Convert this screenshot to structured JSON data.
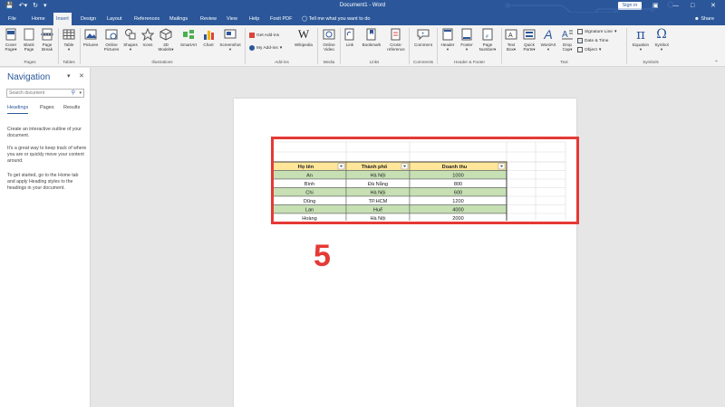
{
  "app": {
    "doc_title": "Document1 - Word",
    "signin": "Sign in",
    "share": "Share",
    "tellme": "Tell me what you want to do"
  },
  "tabs": [
    "File",
    "Home",
    "Insert",
    "Design",
    "Layout",
    "References",
    "Mailings",
    "Review",
    "View",
    "Help",
    "Foxit PDF"
  ],
  "active_tab": "Insert",
  "ribbon": {
    "cover_page": [
      "Cover",
      "Page"
    ],
    "blank_page": [
      "Blank",
      "Page"
    ],
    "page_break": [
      "Page",
      "Break"
    ],
    "table": "Table",
    "pictures": "Pictures",
    "online_pictures": [
      "Online",
      "Pictures"
    ],
    "shapes": "Shapes",
    "icons": "Icons",
    "models_3d": [
      "3D",
      "Models"
    ],
    "smartart": "SmartArt",
    "chart": "Chart",
    "screenshot": "Screenshot",
    "get_addins": "Get Add-ins",
    "my_addins": "My Add-ins",
    "wikipedia": "Wikipedia",
    "online_video": [
      "Online",
      "Video"
    ],
    "link": "Link",
    "bookmark": "Bookmark",
    "cross_reference": [
      "Cross-",
      "reference"
    ],
    "comment": "Comment",
    "header": "Header",
    "footer": "Footer",
    "page_number": [
      "Page",
      "Number"
    ],
    "text_box": [
      "Text",
      "Box"
    ],
    "quick_parts": [
      "Quick",
      "Parts"
    ],
    "wordart": "WordArt",
    "drop_cap": [
      "Drop",
      "Cap"
    ],
    "signature_line": "Signature Line",
    "date_time": "Date & Time",
    "object": "Object",
    "equation": "Equation",
    "symbol": "Symbol",
    "groups": [
      "Pages",
      "Tables",
      "Illustrations",
      "Add-ins",
      "Media",
      "Links",
      "Comments",
      "Header & Footer",
      "Text",
      "Symbols"
    ]
  },
  "navigation": {
    "title": "Navigation",
    "search_placeholder": "Search document",
    "tabs": [
      "Headings",
      "Pages",
      "Results"
    ],
    "text1": "Create an interactive outline of your document.",
    "text2": "It's a great way to keep track of where you are or quickly move your content around.",
    "text3": "To get started, go to the Home tab and apply Heading styles to the headings in your document."
  },
  "table": {
    "headers": [
      "Họ tên",
      "Thành phố",
      "Doanh thu"
    ],
    "rows": [
      [
        "An",
        "Hà Nội",
        "1000"
      ],
      [
        "Bình",
        "Đà Nẵng",
        "800"
      ],
      [
        "Chi",
        "Hà Nội",
        "600"
      ],
      [
        "Dũng",
        "TP.HCM",
        "1200"
      ],
      [
        "Lan",
        "Huế",
        "4000"
      ],
      [
        "Hoàng",
        "Hà Nội",
        "2000"
      ]
    ],
    "header_color": "#ffe699",
    "band_color": "#c6e0b4"
  },
  "annotation_number": "5",
  "colors": {
    "accent": "#2b579a",
    "highlight": "#e53935"
  }
}
